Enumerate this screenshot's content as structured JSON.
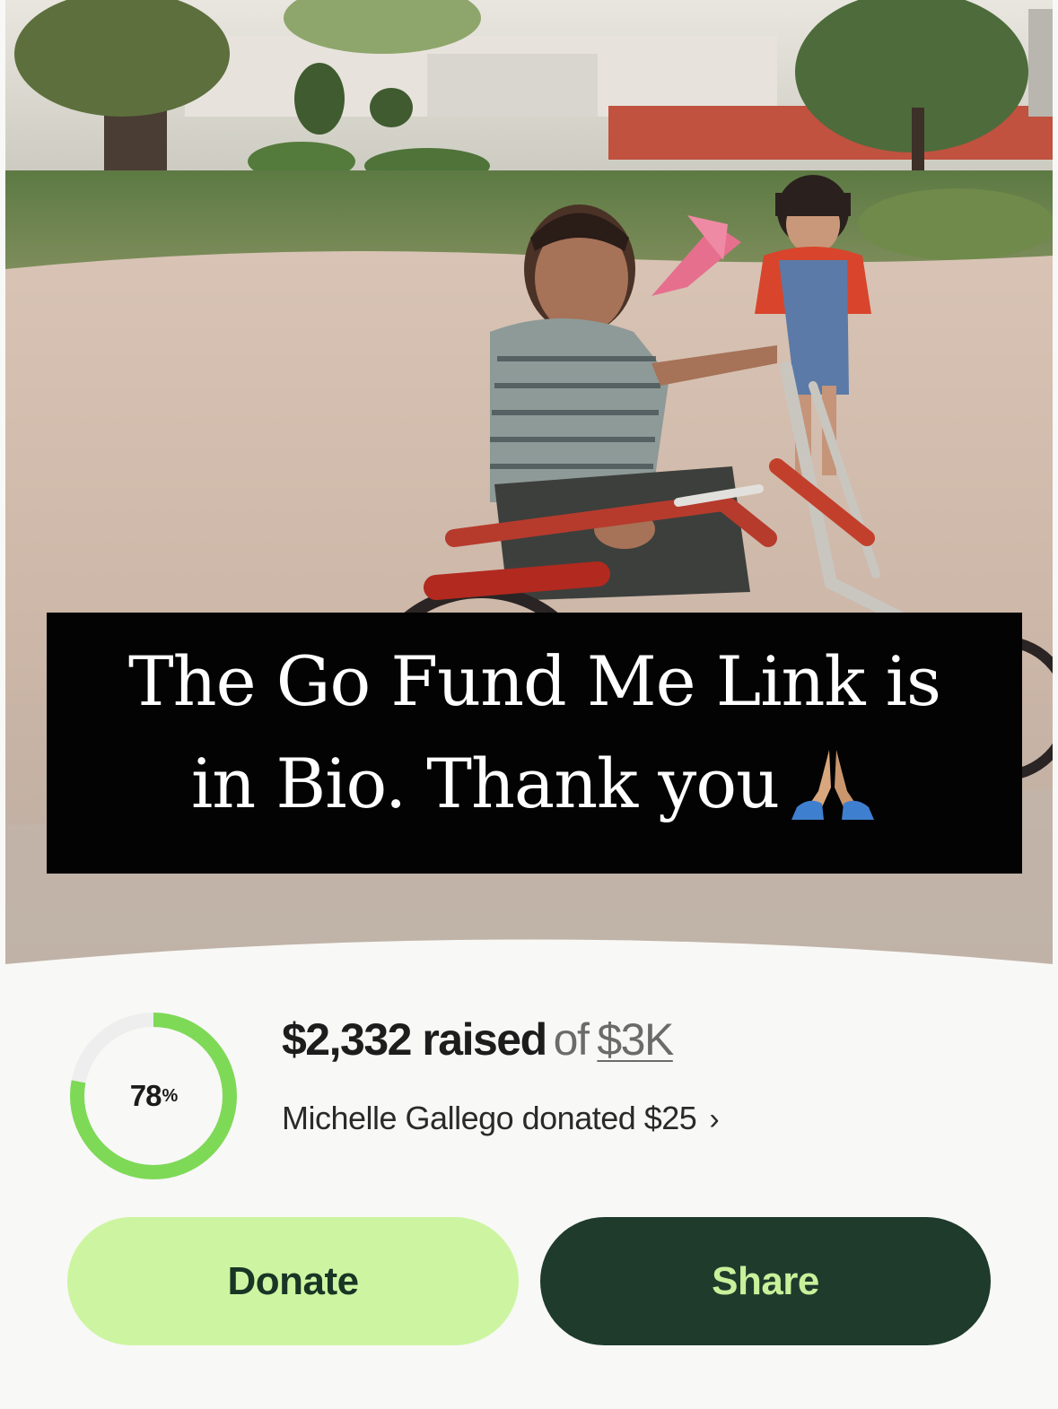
{
  "photo": {
    "caption_line1": "The Go Fund Me Link is",
    "caption_line2": "in Bio. Thank you",
    "caption_emoji": "folded-hands-icon"
  },
  "fundraiser": {
    "progress_percent": 78,
    "progress_fraction": 0.78,
    "progress_number": "78",
    "progress_suffix": "%",
    "raised_amount": "$2,332 raised",
    "of_text": "of",
    "goal": "$3K",
    "recent_donation": "Michelle Gallego donated $25",
    "chevron": "›"
  },
  "actions": {
    "donate_label": "Donate",
    "share_label": "Share"
  },
  "colors": {
    "progress_ring": "#7ed957",
    "progress_track": "#eeeeee",
    "donate_bg": "#cdf5a1",
    "share_bg": "#1e3b2c",
    "share_text": "#c9f09a"
  }
}
